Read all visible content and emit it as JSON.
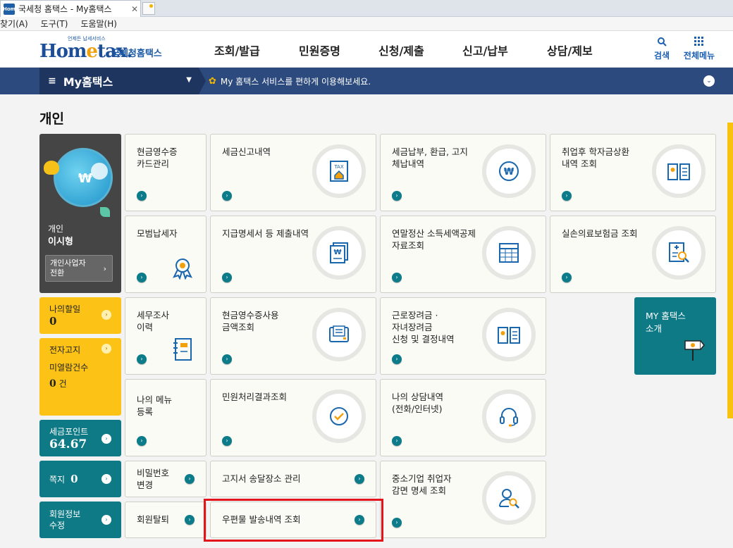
{
  "browser": {
    "tab_title": "국세청 홈택스 - My홈택스",
    "tab_close": "✕",
    "menu": [
      "찾기(A)",
      "도구(T)",
      "도움말(H)"
    ]
  },
  "header": {
    "logo_tag": "언제든 납세서비스",
    "logo_word_a": "Hom",
    "logo_word_e": "e",
    "logo_word_b": "tax.",
    "logo_sub": "국세청홈택스",
    "nav": [
      "조회/발급",
      "민원증명",
      "신청/제출",
      "신고/납부",
      "상담/제보"
    ],
    "search_label": "검색",
    "allmenu_label": "전체메뉴",
    "accent": "#1c5aa6"
  },
  "mybar": {
    "title": "My홈택스",
    "notice": "My 홈택스 서비스를 편하게 이용해보세요."
  },
  "page_title": "개인",
  "profile": {
    "type": "개인",
    "name": "이시형",
    "switch_label": "개인사업자\n전환"
  },
  "side": {
    "todo_label": "나의할일",
    "todo_count": "0",
    "ebill_label1": "전자고지",
    "ebill_label2": "미열람건수",
    "ebill_count": "0",
    "ebill_unit": "건",
    "points_label": "세금포인트",
    "points_value": "64.67",
    "note_label": "쪽지",
    "note_count": "0",
    "member_label": "회원정보\n수정"
  },
  "tiles": {
    "cash_receipt": "현금영수증\n카드관리",
    "tax_report": "세금신고내역",
    "tax_payment": "세금납부, 환급, 고지\n체납내역",
    "student_loan": "취업후 학자금상환\n내역 조회",
    "model_taxpayer": "모범납세자",
    "payment_statement": "지급명세서 등 제출내역",
    "yearend": "연말정산 소득세액공제\n자료조회",
    "medical": "실손의료보험금 조회",
    "tax_audit": "세무조사\n이력",
    "cash_usage": "현금영수증사용\n금액조회",
    "earned_credit": "근로장려금 ·\n자녀장려금\n신청 및 결정내역",
    "my_menu": "나의 메뉴\n등록",
    "civil_result": "민원처리결과조회",
    "consult": "나의 상담내역\n(전화/인터넷)",
    "password": "비밀번호\n변경",
    "notice_place": "고지서 송달장소 관리",
    "sme_employ": "중소기업 취업자\n감면 명세 조회",
    "withdraw": "회원탈퇴",
    "postal": "우편물 발송내역 조회"
  },
  "promo": {
    "label": "MY 홈택스\n소개"
  }
}
